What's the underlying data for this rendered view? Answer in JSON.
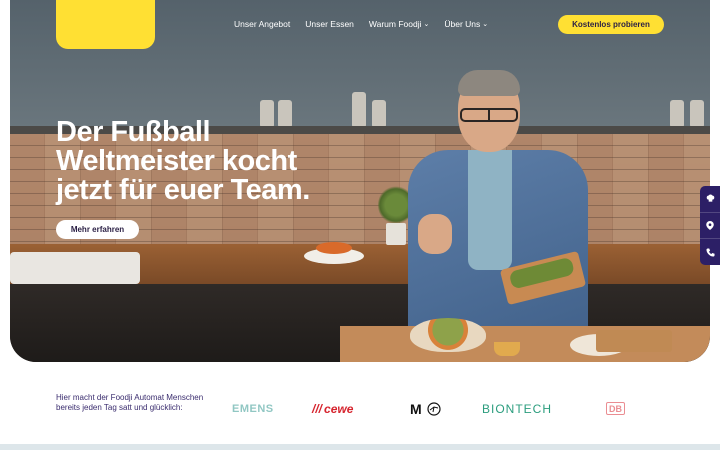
{
  "nav": {
    "items": [
      {
        "label": "Unser Angebot",
        "has_dropdown": false
      },
      {
        "label": "Unser Essen",
        "has_dropdown": false
      },
      {
        "label": "Warum Foodji",
        "has_dropdown": true
      },
      {
        "label": "Über Uns",
        "has_dropdown": true
      }
    ],
    "cta_label": "Kostenlos probieren"
  },
  "hero": {
    "headline_lines": [
      "Der Fußball",
      "Weltmeister kocht",
      "jetzt für euer Team."
    ],
    "button_label": "Mehr erfahren"
  },
  "side_tabs": [
    {
      "icon": "chef-icon"
    },
    {
      "icon": "location-pin-icon"
    },
    {
      "icon": "phone-icon"
    }
  ],
  "trust": {
    "text": "Hier macht der Foodji Automat Menschen bereits jeden Tag satt und glücklich:",
    "brands": [
      {
        "label": "EMENS"
      },
      {
        "label": "cewe"
      },
      {
        "label": "M"
      },
      {
        "label": "BIONTECH"
      },
      {
        "label": "DB"
      }
    ]
  },
  "colors": {
    "brand_yellow": "#ffe033",
    "brand_purple": "#2c1f66",
    "text_purple": "#3a2c6e"
  }
}
